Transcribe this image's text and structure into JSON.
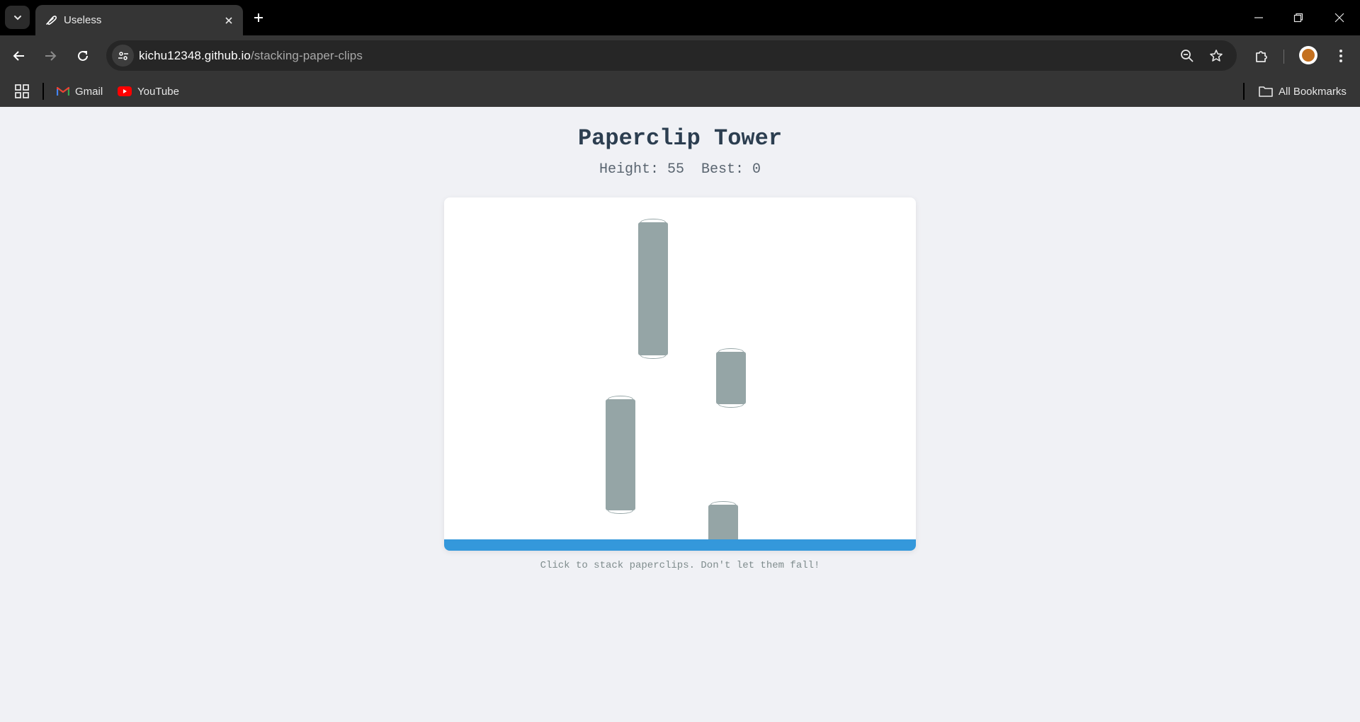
{
  "browser": {
    "tab_title": "Useless",
    "url_host": "kichu12348.github.io",
    "url_path": "/stacking-paper-clips",
    "bookmarks": [
      {
        "label": "Gmail",
        "icon": "gmail-icon"
      },
      {
        "label": "YouTube",
        "icon": "youtube-icon"
      }
    ],
    "all_bookmarks_label": "All Bookmarks"
  },
  "game": {
    "title": "Paperclip Tower",
    "height_label": "Height:",
    "height_value": "55",
    "best_label": "Best:",
    "best_value": "0",
    "instructions": "Click to stack paperclips. Don't let them fall!",
    "colors": {
      "clip": "#95a5a6",
      "ground": "#3498db",
      "title": "#2c3e50",
      "background": "#f0f1f5"
    },
    "paperclip_count": 4
  }
}
